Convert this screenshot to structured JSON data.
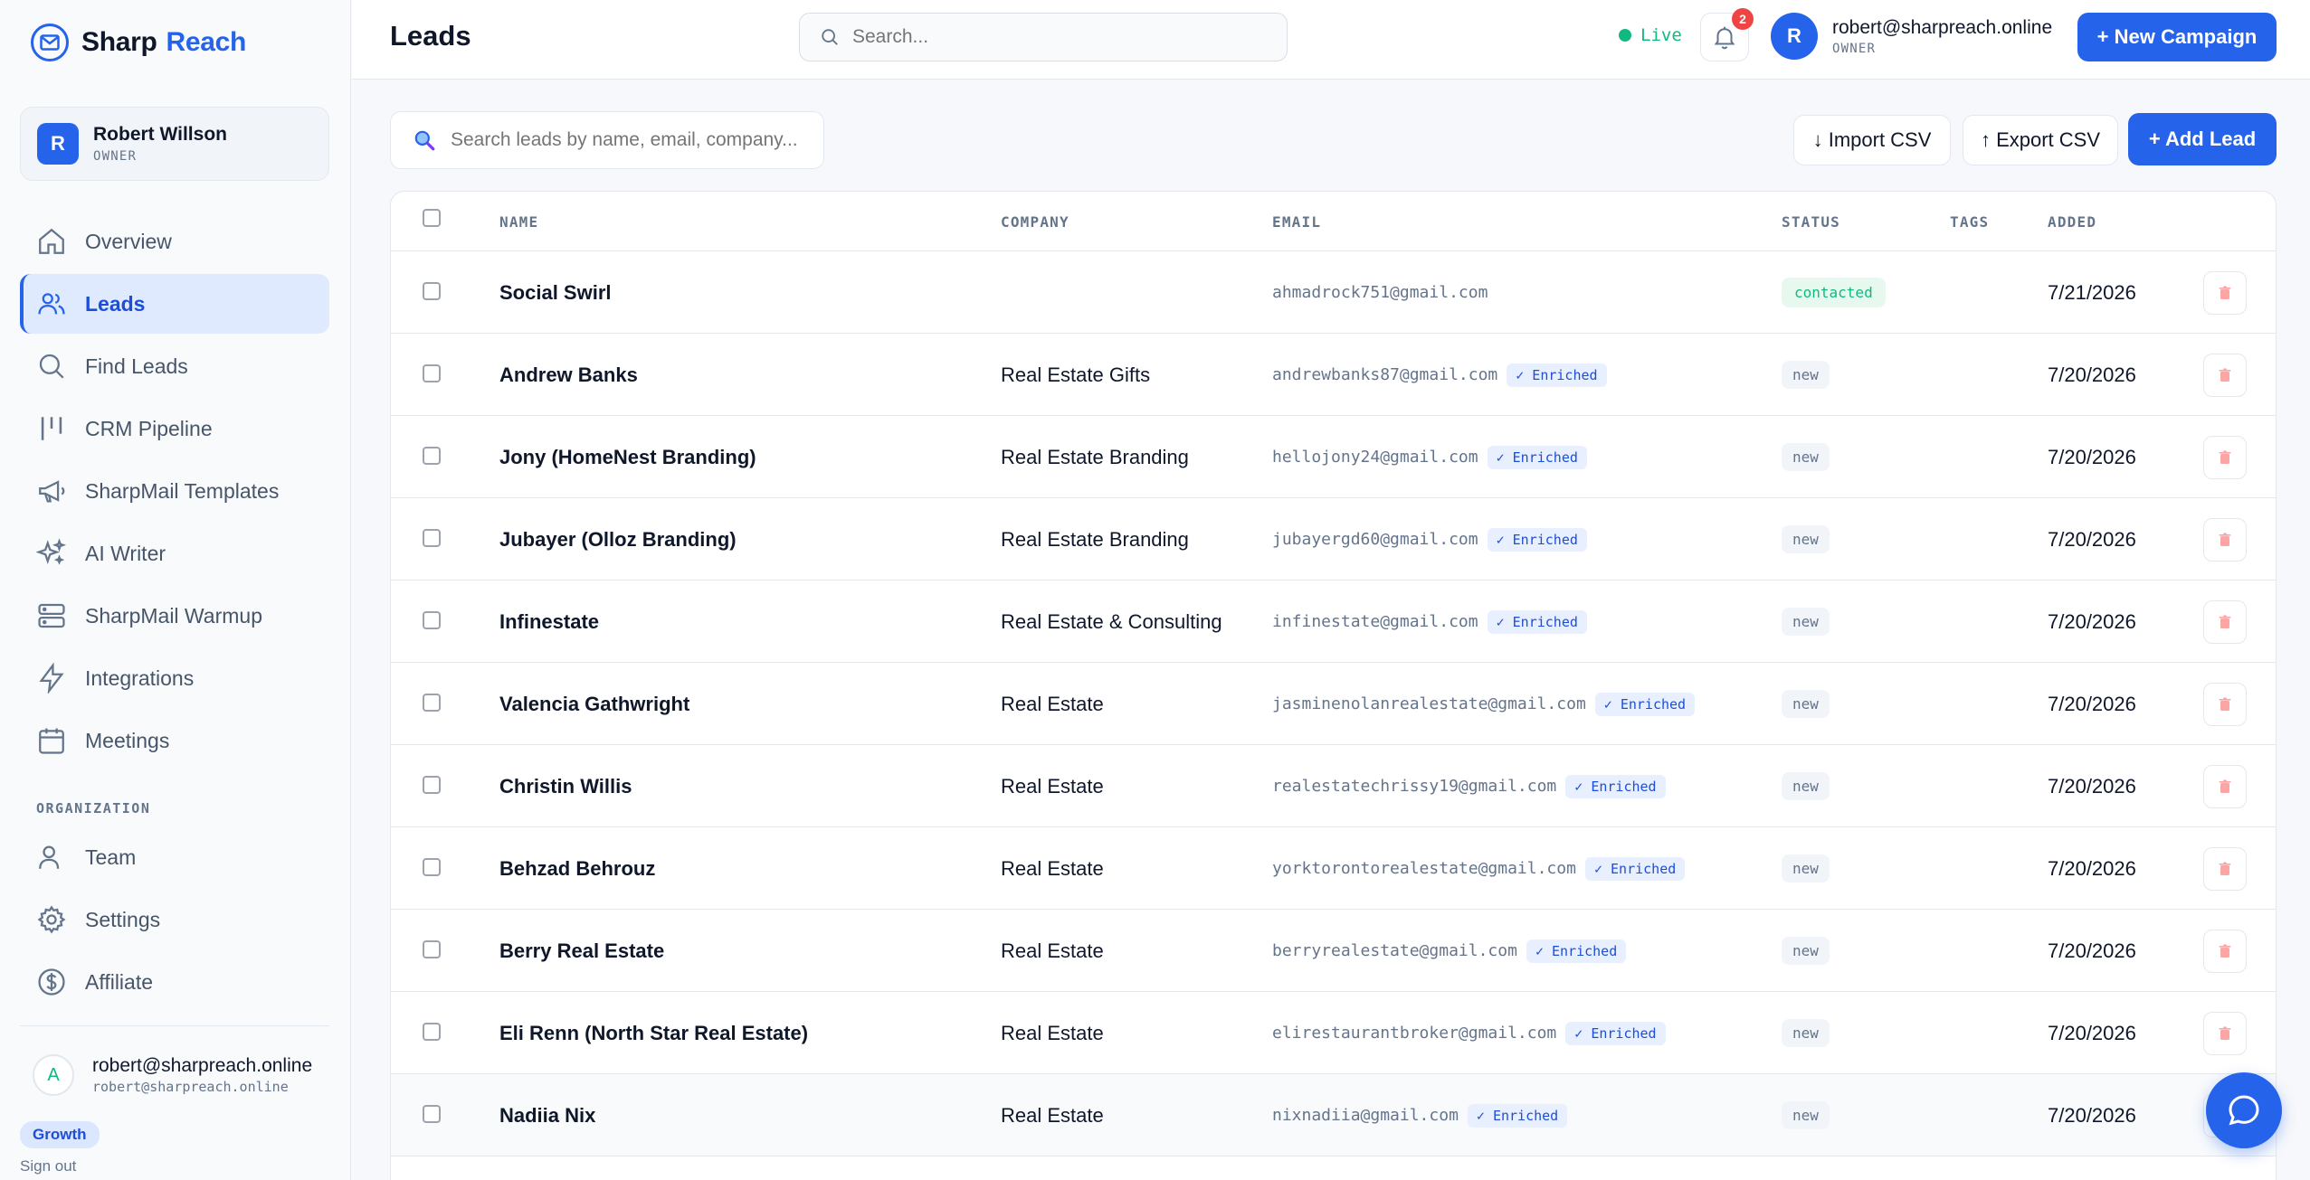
{
  "brand": {
    "name_part1": "Sharp",
    "name_part2": "Reach"
  },
  "sidebar": {
    "user": {
      "avatar_letter": "R",
      "name": "Robert Willson",
      "role": "OWNER"
    },
    "items": [
      {
        "label": "Overview",
        "icon": "home-icon"
      },
      {
        "label": "Leads",
        "icon": "users-icon",
        "active": true
      },
      {
        "label": "Find Leads",
        "icon": "search-icon"
      },
      {
        "label": "CRM Pipeline",
        "icon": "kanban-icon"
      },
      {
        "label": "SharpMail Templates",
        "icon": "megaphone-icon"
      },
      {
        "label": "AI Writer",
        "icon": "sparkles-icon"
      },
      {
        "label": "SharpMail Warmup",
        "icon": "server-icon"
      },
      {
        "label": "Integrations",
        "icon": "bolt-icon"
      },
      {
        "label": "Meetings",
        "icon": "calendar-icon"
      }
    ],
    "org_label": "ORGANIZATION",
    "org_items": [
      {
        "label": "Team",
        "icon": "user-icon"
      },
      {
        "label": "Settings",
        "icon": "gear-icon"
      },
      {
        "label": "Affiliate",
        "icon": "dollar-icon"
      }
    ],
    "bottom_user": {
      "avatar_letter": "A",
      "email": "robert@sharpreach.online",
      "sub": "robert@sharpreach.online"
    },
    "plan": "Growth",
    "sign_out": "Sign out"
  },
  "header": {
    "title": "Leads",
    "search_placeholder": "Search...",
    "live_label": "Live",
    "notifications_count": "2",
    "user": {
      "avatar_letter": "R",
      "email": "robert@sharpreach.online",
      "role": "OWNER"
    },
    "new_campaign": "+ New Campaign"
  },
  "toolbar": {
    "search_placeholder": "Search leads by name, email, company...",
    "import_csv": "↓ Import CSV",
    "export_csv": "↑ Export CSV",
    "add_lead": "+ Add Lead"
  },
  "table": {
    "columns": [
      "NAME",
      "COMPANY",
      "EMAIL",
      "STATUS",
      "TAGS",
      "ADDED"
    ],
    "enriched_label": "✓ Enriched",
    "rows": [
      {
        "name": "Social Swirl",
        "company": "",
        "email": "ahmadrock751@gmail.com",
        "enriched": false,
        "status": "contacted",
        "added": "7/21/2026"
      },
      {
        "name": "Andrew Banks",
        "company": "Real Estate Gifts",
        "email": "andrewbanks87@gmail.com",
        "enriched": true,
        "status": "new",
        "added": "7/20/2026"
      },
      {
        "name": "Jony (HomeNest Branding)",
        "company": "Real Estate Branding",
        "email": "hellojony24@gmail.com",
        "enriched": true,
        "status": "new",
        "added": "7/20/2026"
      },
      {
        "name": "Jubayer (Olloz Branding)",
        "company": "Real Estate Branding",
        "email": "jubayergd60@gmail.com",
        "enriched": true,
        "status": "new",
        "added": "7/20/2026"
      },
      {
        "name": "Infinestate",
        "company": "Real Estate & Consulting",
        "email": "infinestate@gmail.com",
        "enriched": true,
        "status": "new",
        "added": "7/20/2026"
      },
      {
        "name": "Valencia Gathwright",
        "company": "Real Estate",
        "email": "jasminenolanrealestate@gmail.com",
        "enriched": true,
        "status": "new",
        "added": "7/20/2026"
      },
      {
        "name": "Christin Willis",
        "company": "Real Estate",
        "email": "realestatechrissy19@gmail.com",
        "enriched": true,
        "status": "new",
        "added": "7/20/2026"
      },
      {
        "name": "Behzad Behrouz",
        "company": "Real Estate",
        "email": "yorktorontorealestate@gmail.com",
        "enriched": true,
        "status": "new",
        "added": "7/20/2026"
      },
      {
        "name": "Berry Real Estate",
        "company": "Real Estate",
        "email": "berryrealestate@gmail.com",
        "enriched": true,
        "status": "new",
        "added": "7/20/2026"
      },
      {
        "name": "Eli Renn (North Star Real Estate)",
        "company": "Real Estate",
        "email": "elirestaurantbroker@gmail.com",
        "enriched": true,
        "status": "new",
        "added": "7/20/2026"
      },
      {
        "name": "Nadiia Nix",
        "company": "Real Estate",
        "email": "nixnadiia@gmail.com",
        "enriched": true,
        "status": "new",
        "added": "7/20/2026"
      }
    ]
  },
  "colors": {
    "accent": "#2563eb",
    "live": "#10b981",
    "danger": "#ef4444"
  }
}
